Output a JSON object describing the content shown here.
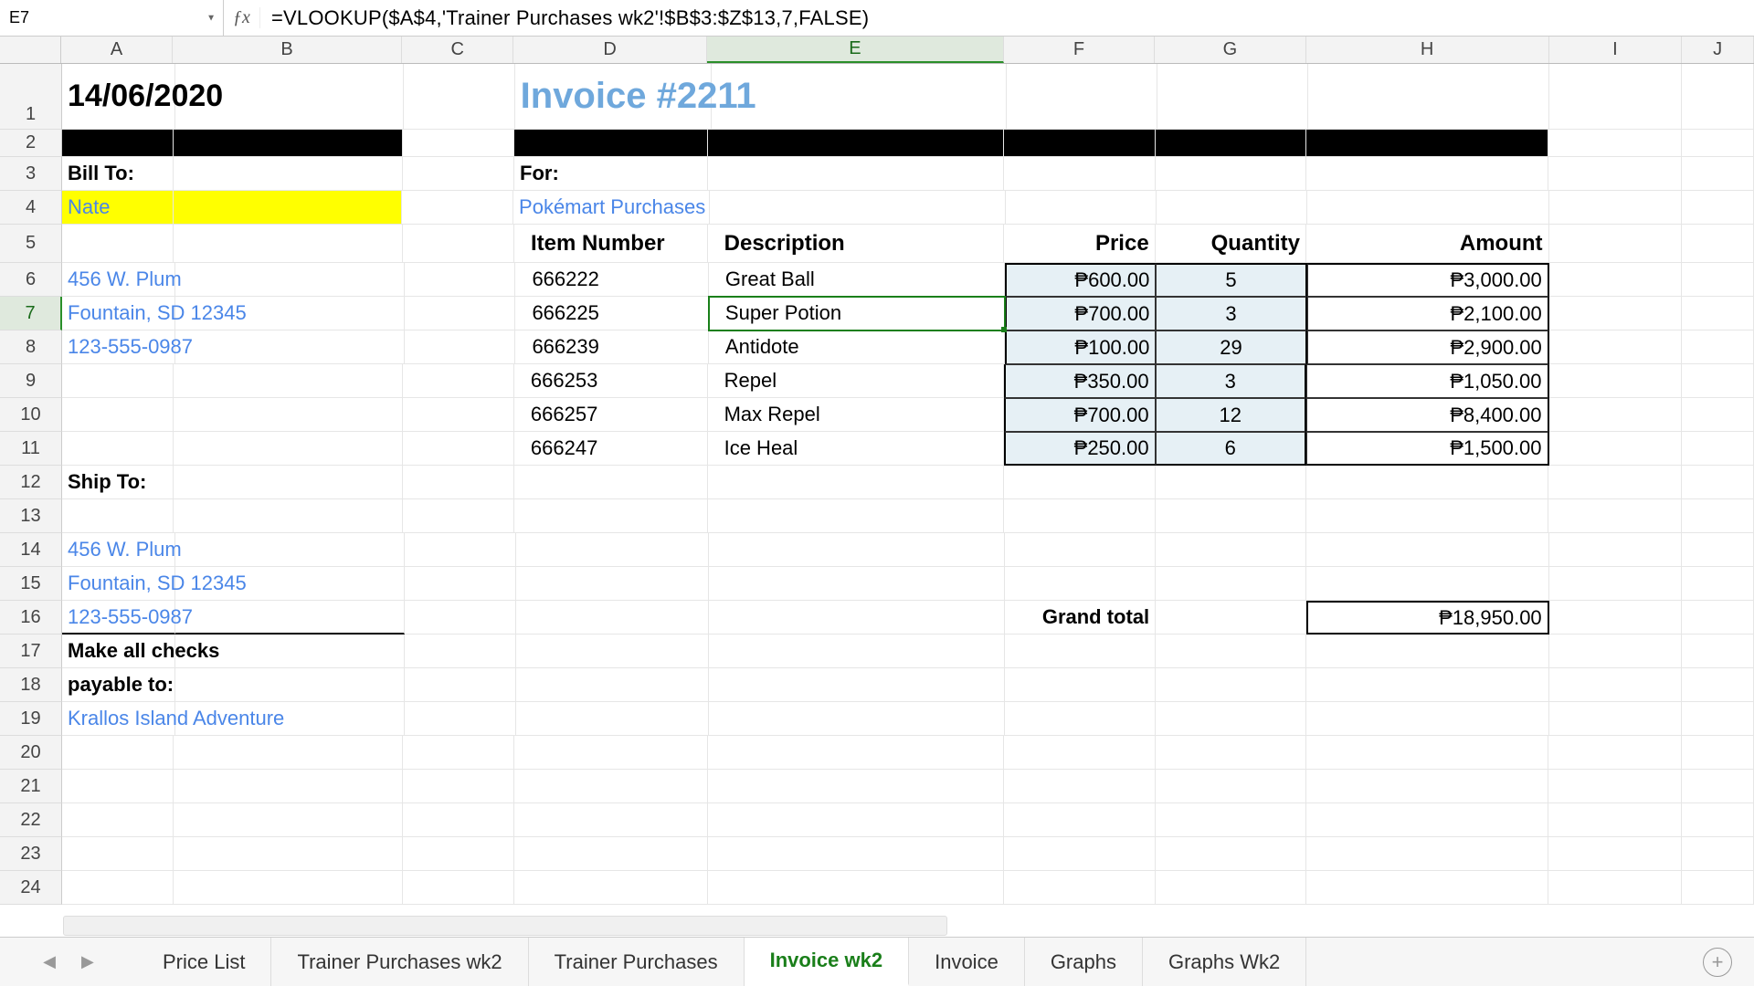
{
  "name_box": "E7",
  "formula": "=VLOOKUP($A$4,'Trainer Purchases wk2'!$B$3:$Z$13,7,FALSE)",
  "columns": [
    "A",
    "B",
    "C",
    "D",
    "E",
    "F",
    "G",
    "H",
    "I",
    "J"
  ],
  "selected_col": "E",
  "selected_row": 7,
  "rows": 24,
  "date": "14/06/2020",
  "invoice_title": "Invoice #2211",
  "bill_to_label": "Bill To:",
  "bill_to_name": "Nate",
  "for_label": "For:",
  "for_value": "Pokémart Purchases",
  "addr1": "456 W. Plum",
  "addr2": "Fountain, SD 12345",
  "phone": "123-555-0987",
  "ship_to_label": "Ship To:",
  "checks_l1": "Make all checks",
  "checks_l2": "payable to:",
  "payable_to": "Krallos Island Adventure",
  "headers": {
    "item": "Item Number",
    "desc": "Description",
    "price": "Price",
    "qty": "Quantity",
    "amount": "Amount"
  },
  "items": [
    {
      "num": "666222",
      "desc": "Great Ball",
      "price": "₱600.00",
      "qty": "5",
      "amount": "₱3,000.00"
    },
    {
      "num": "666225",
      "desc": "Super Potion",
      "price": "₱700.00",
      "qty": "3",
      "amount": "₱2,100.00"
    },
    {
      "num": "666239",
      "desc": "Antidote",
      "price": "₱100.00",
      "qty": "29",
      "amount": "₱2,900.00"
    },
    {
      "num": "666253",
      "desc": "Repel",
      "price": "₱350.00",
      "qty": "3",
      "amount": "₱1,050.00"
    },
    {
      "num": "666257",
      "desc": "Max Repel",
      "price": "₱700.00",
      "qty": "12",
      "amount": "₱8,400.00"
    },
    {
      "num": "666247",
      "desc": "Ice Heal",
      "price": "₱250.00",
      "qty": "6",
      "amount": "₱1,500.00"
    }
  ],
  "grand_total_label": "Grand total",
  "grand_total": "₱18,950.00",
  "tabs": [
    "Price List",
    "Trainer Purchases wk2",
    "Trainer Purchases",
    "Invoice wk2",
    "Invoice",
    "Graphs",
    "Graphs Wk2"
  ],
  "active_tab": "Invoice wk2"
}
